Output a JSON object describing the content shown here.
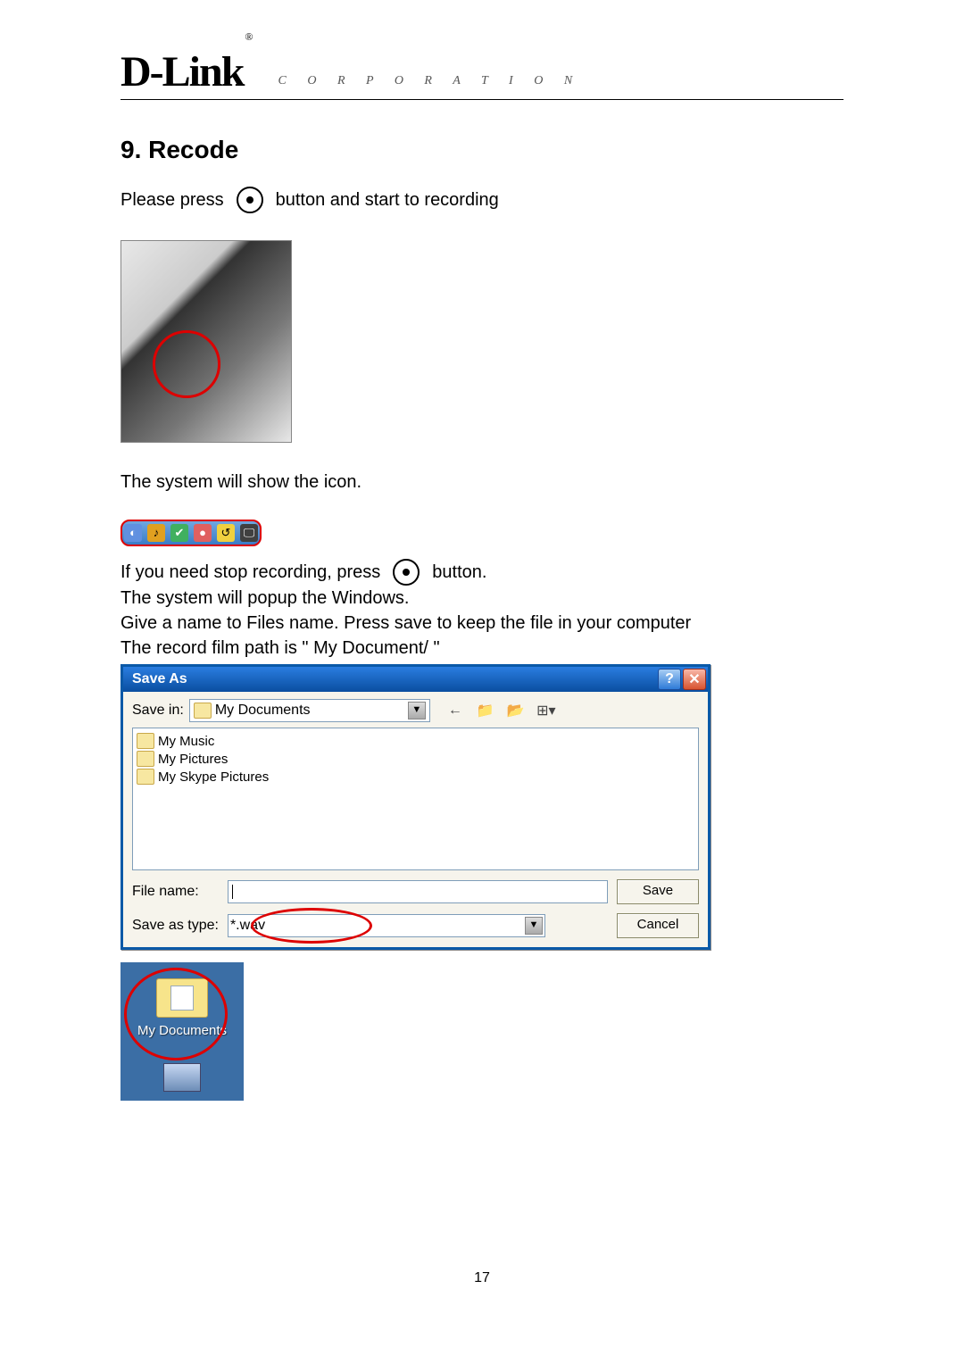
{
  "header": {
    "logo": "D-Link",
    "registered": "®",
    "corporation": "C O R P O R A T I O N"
  },
  "section": {
    "title": "9. Recode"
  },
  "lines": {
    "press1a": "Please press",
    "press1b": "button and start to recording",
    "showIcon": "The system will show the icon.",
    "stop1a": "If you need stop recording, press",
    "stop1b": "button.",
    "popup": "The system will popup the Windows.",
    "give": "Give a name to Files name. Press save to keep the file in your computer",
    "path": "The record film path is \" My Document/ \""
  },
  "saveAs": {
    "title": "Save As",
    "saveInLabel": "Save in:",
    "saveInValue": "My Documents",
    "fileItems": [
      "My Music",
      "My Pictures",
      "My Skype Pictures"
    ],
    "fileNameLabel": "File name:",
    "fileNameValue": "",
    "saveAsTypeLabel": "Save as type:",
    "saveAsTypeValue": "*.wav",
    "saveBtn": "Save",
    "cancelBtn": "Cancel"
  },
  "desktop": {
    "label": "My Documents"
  },
  "pageNumber": "17"
}
